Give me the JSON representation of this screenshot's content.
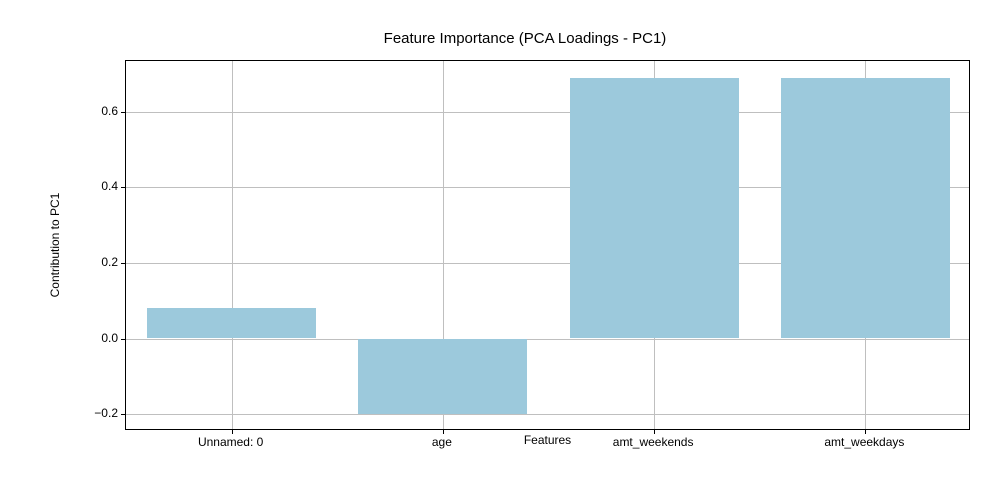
{
  "chart_data": {
    "type": "bar",
    "title": "Feature Importance (PCA Loadings - PC1)",
    "xlabel": "Features",
    "ylabel": "Contribution to PC1",
    "categories": [
      "Unnamed: 0",
      "age",
      "amt_weekends",
      "amt_weekdays"
    ],
    "values": [
      0.08,
      -0.2,
      0.69,
      0.69
    ],
    "ylim": [
      -0.245,
      0.735
    ],
    "y_ticks": [
      -0.2,
      0.0,
      0.2,
      0.4,
      0.6
    ],
    "y_tick_labels": [
      "−0.2",
      "0.0",
      "0.2",
      "0.4",
      "0.6"
    ]
  }
}
